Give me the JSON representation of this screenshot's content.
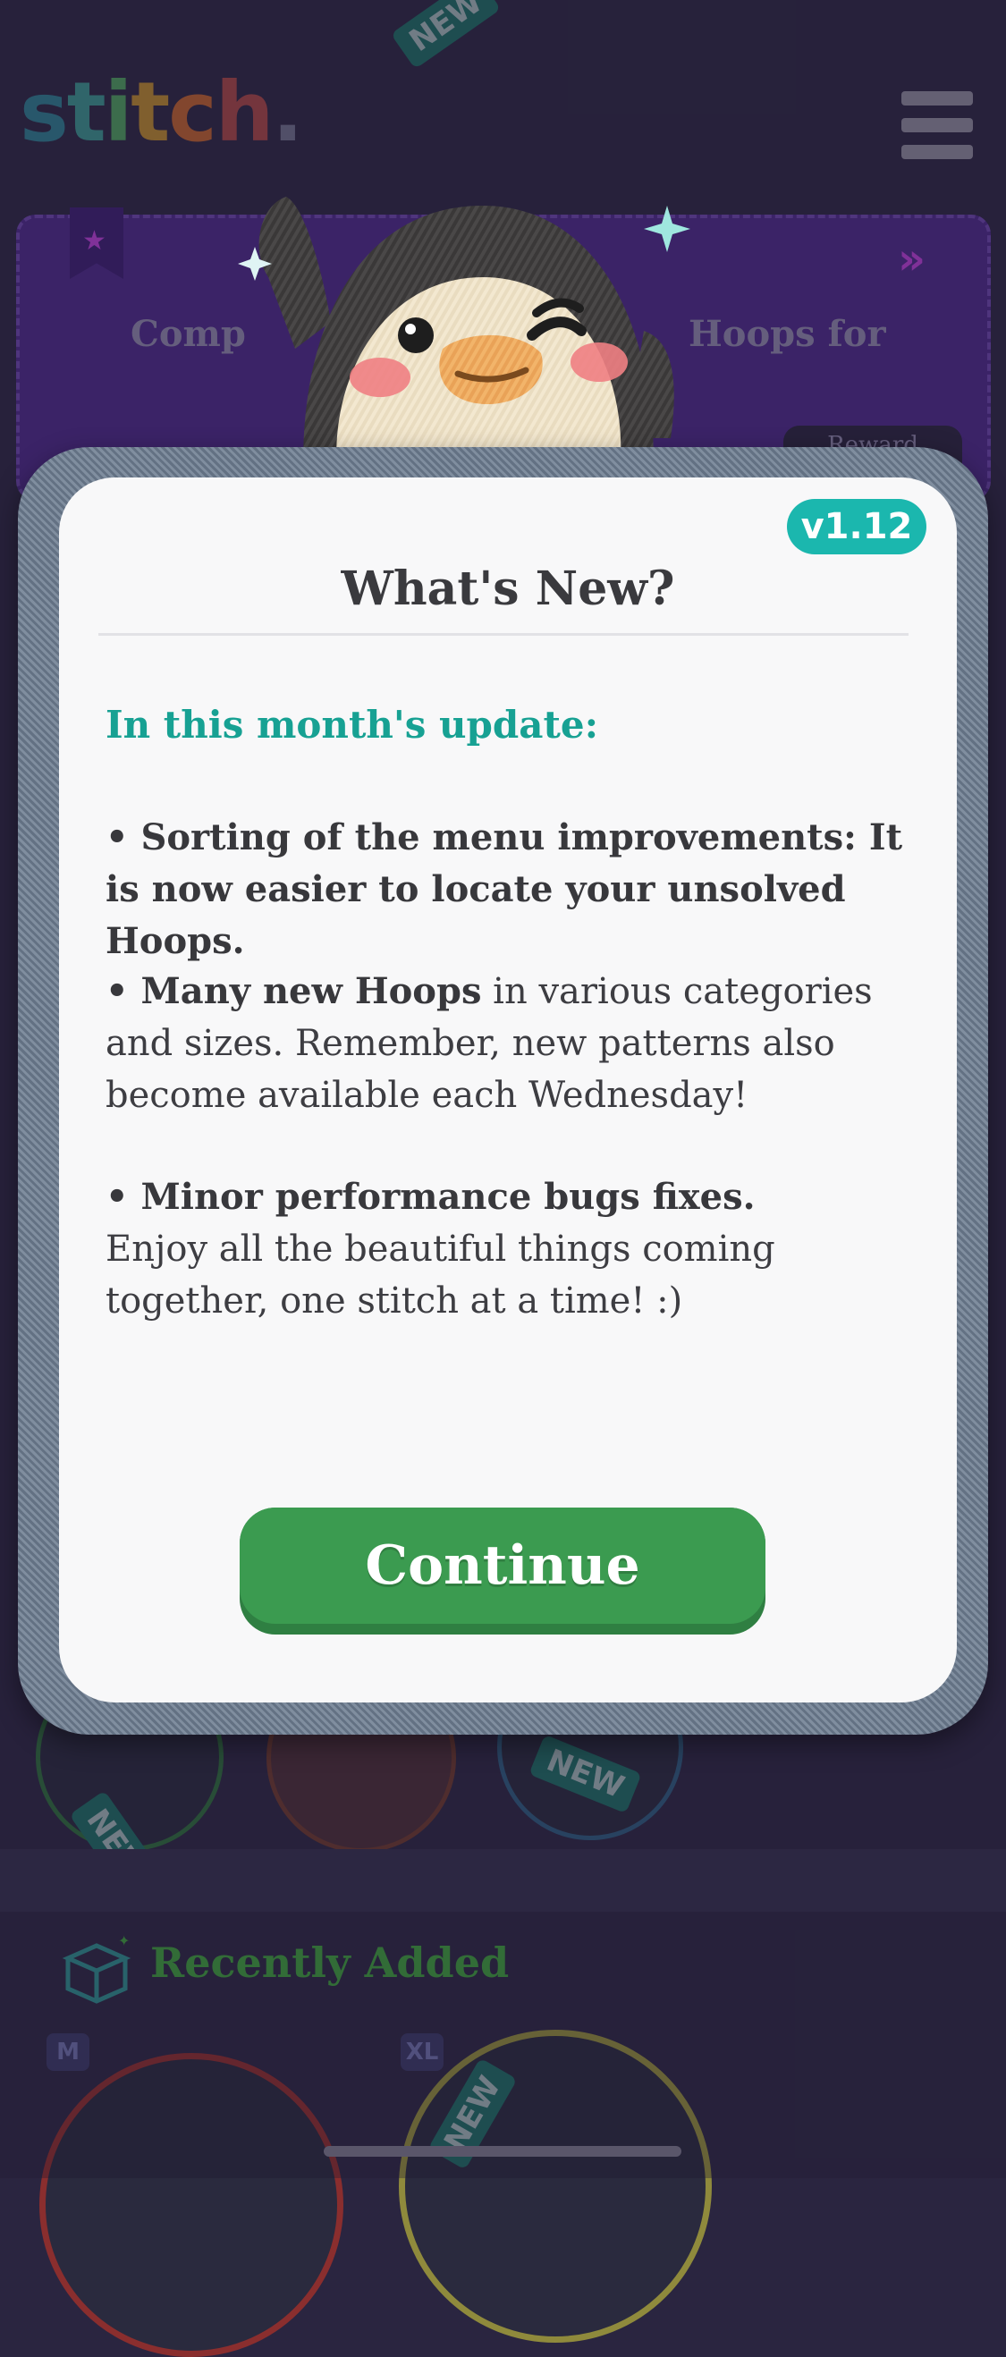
{
  "app": {
    "logo_text": "stitch."
  },
  "background": {
    "banner_text_left": "Comp",
    "banner_text_right": "Hoops for",
    "reward_label": "Reward",
    "new_tag": "NEW",
    "recently_added": "Recently Added",
    "size_m": "M",
    "size_xl": "XL"
  },
  "modal": {
    "version": "v1.12",
    "title": "What's New?",
    "update_heading": "In this month's update:",
    "item1_bold": "• Sorting of the menu improvements: It is now easier to locate your unsolved Hoops.",
    "item2_bold": "• Many new Hoops",
    "item2_rest": " in various categories and sizes. Remember, new patterns also become available each Wednesday!",
    "item3_bold": "• Minor performance bugs fixes.",
    "item3_rest": "Enjoy all the beautiful things coming together, one stitch at a time! :)",
    "continue_label": "Continue"
  },
  "colors": {
    "accent_teal": "#1bb7ae",
    "button_green": "#3b9b50",
    "background": "#2d2743"
  }
}
